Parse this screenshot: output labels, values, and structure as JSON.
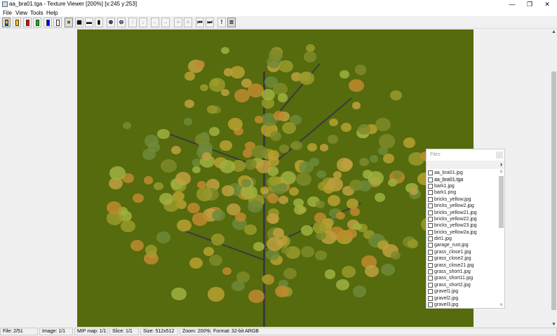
{
  "window": {
    "title": "aa_bra01.tga - Texture Viewer [200%]  [x:245 y:253]",
    "minimize": "—",
    "maximize": "❐",
    "close": "✕"
  },
  "menu": [
    "File",
    "View",
    "Tools",
    "Help"
  ],
  "toolbar": [
    {
      "name": "channel-rgba",
      "glyph": "",
      "color": "#ff0000"
    },
    {
      "name": "channel-alpha-rgb",
      "glyph": "",
      "color": "#ffcc00"
    },
    {
      "name": "channel-red",
      "glyph": "",
      "color": "#ff0000"
    },
    {
      "name": "channel-green",
      "glyph": "",
      "color": "#00c000"
    },
    {
      "name": "channel-blue",
      "glyph": "",
      "color": "#0000ff"
    },
    {
      "name": "channel-alpha",
      "glyph": "",
      "color": "#ffffff"
    },
    {
      "name": "background-solid",
      "glyph": "■",
      "color": "#6b6b00"
    },
    {
      "name": "background-checker",
      "glyph": "▦",
      "color": "#000000"
    },
    {
      "name": "fit-width",
      "glyph": "▬",
      "color": "#000000"
    },
    {
      "name": "fit-height",
      "glyph": "▮",
      "color": "#000000"
    },
    {
      "name": "zoom-in",
      "glyph": "⊕",
      "color": "#003"
    },
    {
      "name": "zoom-out",
      "glyph": "⊖",
      "color": "#003"
    },
    {
      "name": "mip-up",
      "glyph": "↑",
      "color": "#aaa"
    },
    {
      "name": "mip-down",
      "glyph": "↓",
      "color": "#aaa"
    },
    {
      "name": "image-prev",
      "glyph": "←",
      "color": "#aaa"
    },
    {
      "name": "image-next",
      "glyph": "→",
      "color": "#aaa"
    },
    {
      "name": "slice-prev",
      "glyph": "≡",
      "color": "#aaa"
    },
    {
      "name": "slice-next",
      "glyph": "≡",
      "color": "#aaa"
    },
    {
      "name": "file-first",
      "glyph": "⏮",
      "color": "#000"
    },
    {
      "name": "file-last",
      "glyph": "⏭",
      "color": "#000"
    },
    {
      "name": "info",
      "glyph": "!",
      "color": "#000"
    },
    {
      "name": "files-panel",
      "glyph": "≣",
      "color": "#000"
    }
  ],
  "files": {
    "title": "Files",
    "expand": "›",
    "items": [
      "aa_bra01.jpg",
      "aa_bra01.tga",
      "bark1.jpg",
      "bark1.png",
      "bricks_yellow.jpg",
      "bricks_yellow2.jpg",
      "bricks_yellow21.jpg",
      "bricks_yellow22.jpg",
      "bricks_yellow23.jpg",
      "bricks_yellow2a.jpg",
      "dirt1.jpg",
      "garage_rust.jpg",
      "grass_close1.jpg",
      "grass_close2.jpg",
      "grass_close21.jpg",
      "grass_short1.jpg",
      "grass_short11.jpg",
      "grass_short2.jpg",
      "gravel1.jpg",
      "gravel2.jpg",
      "gravel3.jpg"
    ],
    "selected": 1
  },
  "status": [
    "File: 2/51",
    "Image: 1/1",
    "MIP map: 1/1",
    "Slice: 1/1",
    "Size: 512x512",
    "Zoom: 200%",
    "Format: 32-bit ARGB"
  ],
  "canvas_bg": "#556b0d"
}
